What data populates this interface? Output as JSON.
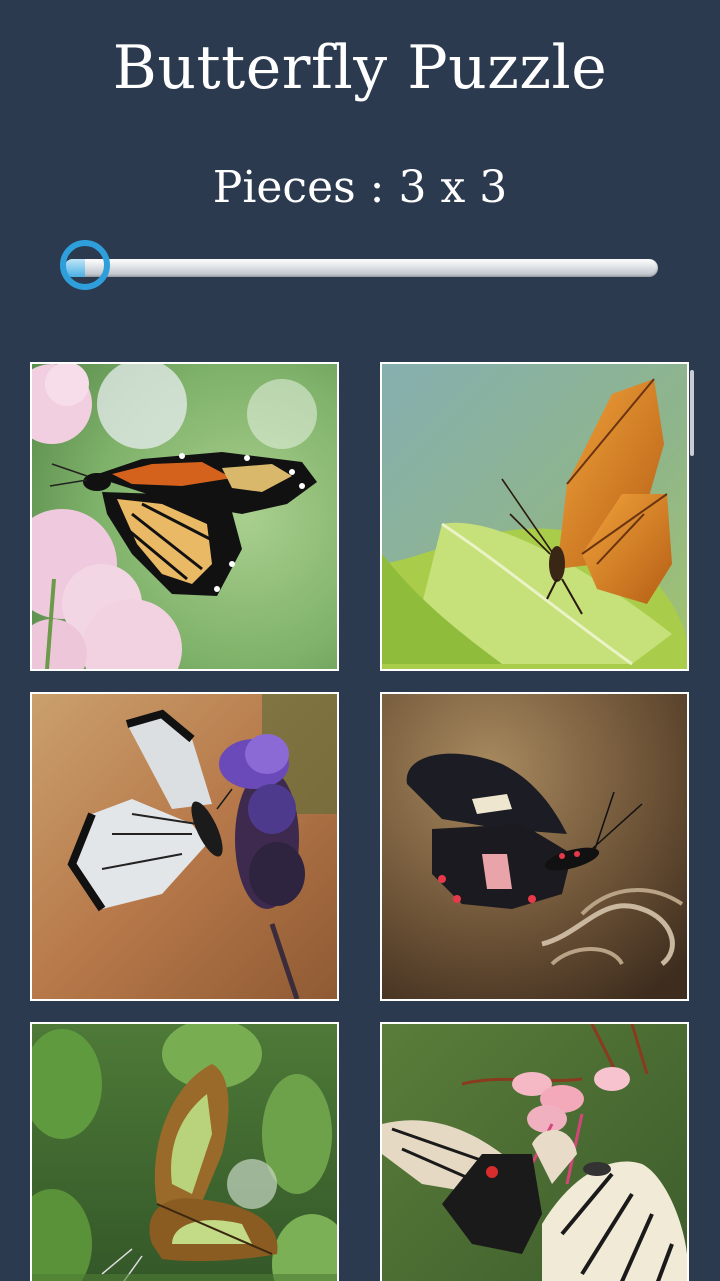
{
  "header": {
    "title": "Butterfly Puzzle"
  },
  "difficulty": {
    "pieces_label": "Pieces : 3 x 3",
    "slider_value_fraction": 0.0,
    "track_color": "#e6e9ec",
    "thumb_color": "#2f9fdc"
  },
  "gallery": {
    "images": [
      {
        "subject": "monarch butterfly on pink flowers",
        "icon": "monarch-image"
      },
      {
        "subject": "orange butterfly on green leaf",
        "icon": "julia-image"
      },
      {
        "subject": "white and black butterfly on lavender",
        "icon": "lavender-image"
      },
      {
        "subject": "black and pink butterfly on twig",
        "icon": "swallowtail-image"
      },
      {
        "subject": "green malachite butterfly among leaves",
        "icon": "malachite-image"
      },
      {
        "subject": "two butterflies on pink blossom",
        "icon": "pair-image"
      }
    ]
  },
  "colors": {
    "background": "#2b3a4f",
    "text": "#ffffff",
    "tile_border": "#ffffff"
  }
}
